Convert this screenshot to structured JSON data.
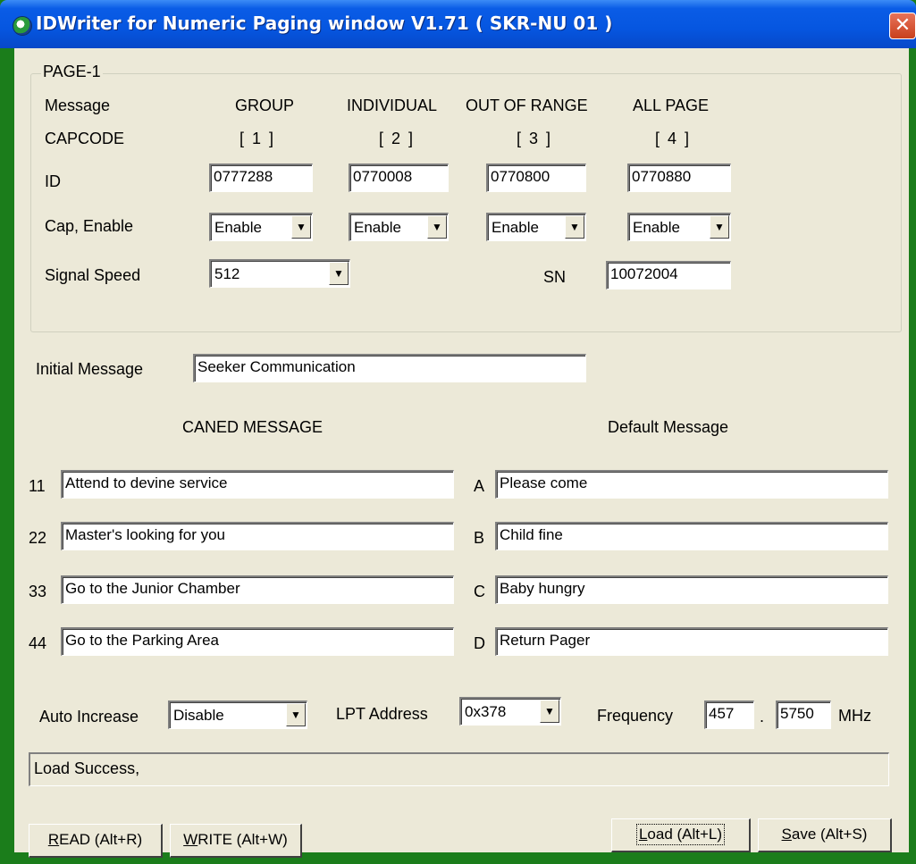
{
  "window": {
    "title": "IDWriter for Numeric Paging window V1.71 ( SKR-NU 01 )",
    "close_glyph": "✕"
  },
  "page1": {
    "legend": "PAGE-1",
    "message_label": "Message",
    "capcode_label": "CAPCODE",
    "id_label": "ID",
    "cap_enable_label": "Cap, Enable",
    "signal_speed_label": "Signal Speed",
    "sn_label": "SN",
    "columns": [
      {
        "message": "GROUP",
        "capcode": "[ 1 ]",
        "id": "0777288",
        "enable": "Enable"
      },
      {
        "message": "INDIVIDUAL",
        "capcode": "[ 2 ]",
        "id": "0770008",
        "enable": "Enable"
      },
      {
        "message": "OUT OF RANGE",
        "capcode": "[ 3 ]",
        "id": "0770800",
        "enable": "Enable"
      },
      {
        "message": "ALL PAGE",
        "capcode": "[ 4 ]",
        "id": "0770880",
        "enable": "Enable"
      }
    ],
    "signal_speed": "512",
    "sn": "10072004"
  },
  "initial_message": {
    "label": "Initial Message",
    "value": "Seeker Communication"
  },
  "caned": {
    "header": "CANED MESSAGE",
    "items": [
      {
        "code": "11",
        "value": "Attend to devine service"
      },
      {
        "code": "22",
        "value": "Master's looking for you"
      },
      {
        "code": "33",
        "value": "Go to the Junior Chamber"
      },
      {
        "code": "44",
        "value": "Go to the Parking Area"
      }
    ]
  },
  "default": {
    "header": "Default Message",
    "items": [
      {
        "code": "A",
        "value": "Please come"
      },
      {
        "code": "B",
        "value": "Child fine"
      },
      {
        "code": "C",
        "value": "Baby hungry"
      },
      {
        "code": "D",
        "value": "Return Pager"
      }
    ]
  },
  "bottom": {
    "auto_increase_label": "Auto Increase",
    "auto_increase": "Disable",
    "lpt_label": "LPT Address",
    "lpt": "0x378",
    "frequency_label": "Frequency",
    "freq_major": "457",
    "freq_sep": ".",
    "freq_minor": "5750",
    "mhz": "MHz"
  },
  "status": "Load Success,",
  "buttons": {
    "read_key": "R",
    "read_rest": "EAD (Alt+R)",
    "write_key": "W",
    "write_rest": "RITE (Alt+W)",
    "load_key": "L",
    "load_rest": "oad (Alt+L)",
    "save_key": "S",
    "save_rest": "ave (Alt+S)"
  },
  "colors": {
    "titlebar": "#0656e0",
    "frame": "#1b7d1b",
    "face": "#ece9d8",
    "close": "#c8401c"
  }
}
